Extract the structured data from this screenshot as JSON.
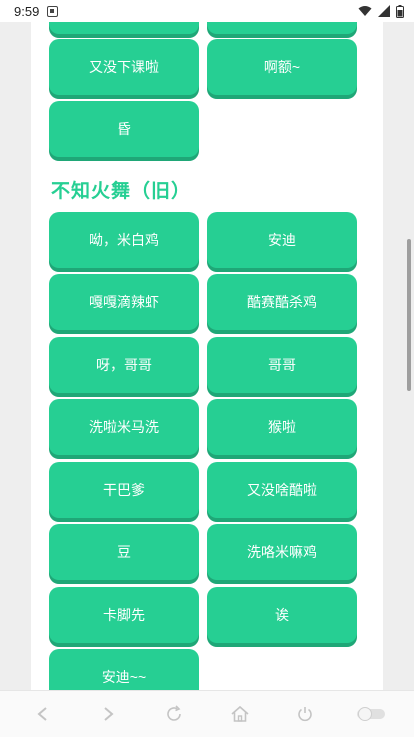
{
  "status_bar": {
    "time": "9:59",
    "icons": [
      "notification-icon",
      "wifi-icon",
      "signal-icon",
      "battery-icon"
    ]
  },
  "top_partial_buttons": [
    "",
    ""
  ],
  "group_1": {
    "buttons": [
      "又没下课啦",
      "啊额~",
      "昏"
    ]
  },
  "group_2": {
    "title": "不知火舞（旧）",
    "buttons": [
      "呦，米白鸡",
      "安迪",
      "嘎嘎滴辣虾",
      "酷赛酷杀鸡",
      "呀，哥哥",
      "哥哥",
      "洗啦米马洗",
      "猴啦",
      "干巴爹",
      "又没啥酷啦",
      "豆",
      "洗咯米嘛鸡",
      "卡脚先",
      "诶",
      "安迪~~"
    ]
  },
  "colors": {
    "accent": "#26cf93",
    "accent_shadow": "#1fa777",
    "title": "#26cf93"
  },
  "bottom_nav": {
    "icons": [
      "back-icon",
      "forward-icon",
      "refresh-icon",
      "home-icon",
      "power-icon",
      "toggle-icon"
    ]
  }
}
